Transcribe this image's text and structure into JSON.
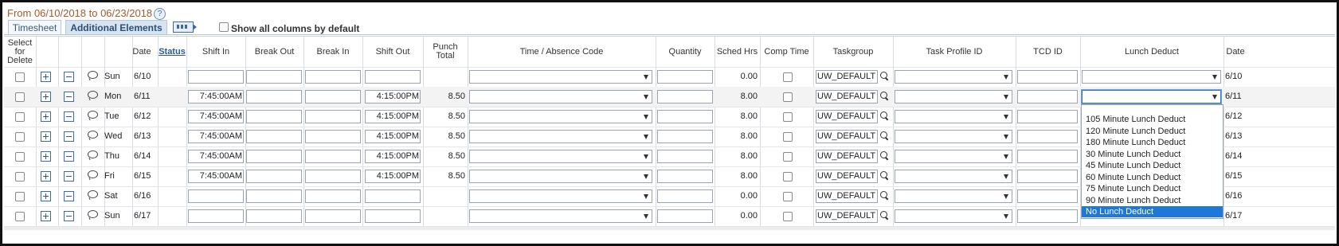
{
  "header": {
    "range_title": "From 06/10/2018 to 06/23/2018",
    "help_glyph": "?",
    "tabs": [
      "Timesheet",
      "Additional Elements"
    ],
    "active_tab": "Additional Elements",
    "show_all_label": "Show all columns by default"
  },
  "columns": {
    "select_delete": "Select for Delete",
    "date": "Date",
    "status": "Status",
    "shift_in": "Shift In",
    "break_out": "Break Out",
    "break_in": "Break In",
    "shift_out": "Shift Out",
    "punch_total": "Punch Total",
    "time_absence": "Time / Absence Code",
    "quantity": "Quantity",
    "sched_hrs": "Sched Hrs",
    "comp_time": "Comp Time",
    "taskgroup": "Taskgroup",
    "task_profile": "Task Profile ID",
    "tcd_id": "TCD ID",
    "lunch_deduct": "Lunch Deduct",
    "date2": "Date"
  },
  "rows": [
    {
      "day": "Sun",
      "date": "6/10",
      "shift_in": "",
      "shift_out": "",
      "punch_total": "",
      "sched": "0.00",
      "taskgroup": "UW_DEFAULT",
      "date2": "6/10"
    },
    {
      "day": "Mon",
      "date": "6/11",
      "shift_in": "7:45:00AM",
      "shift_out": "4:15:00PM",
      "punch_total": "8.50",
      "sched": "8.00",
      "taskgroup": "UW_DEFAULT",
      "date2": "6/11"
    },
    {
      "day": "Tue",
      "date": "6/12",
      "shift_in": "7:45:00AM",
      "shift_out": "4:15:00PM",
      "punch_total": "8.50",
      "sched": "8.00",
      "taskgroup": "UW_DEFAULT",
      "date2": "6/12"
    },
    {
      "day": "Wed",
      "date": "6/13",
      "shift_in": "7:45:00AM",
      "shift_out": "4:15:00PM",
      "punch_total": "8.50",
      "sched": "8.00",
      "taskgroup": "UW_DEFAULT",
      "date2": "6/13"
    },
    {
      "day": "Thu",
      "date": "6/14",
      "shift_in": "7:45:00AM",
      "shift_out": "4:15:00PM",
      "punch_total": "8.50",
      "sched": "8.00",
      "taskgroup": "UW_DEFAULT",
      "date2": "6/14"
    },
    {
      "day": "Fri",
      "date": "6/15",
      "shift_in": "7:45:00AM",
      "shift_out": "4:15:00PM",
      "punch_total": "8.50",
      "sched": "8.00",
      "taskgroup": "UW_DEFAULT",
      "date2": "6/15"
    },
    {
      "day": "Sat",
      "date": "6/16",
      "shift_in": "",
      "shift_out": "",
      "punch_total": "",
      "sched": "0.00",
      "taskgroup": "UW_DEFAULT",
      "date2": "6/16"
    },
    {
      "day": "Sun",
      "date": "6/17",
      "shift_in": "",
      "shift_out": "",
      "punch_total": "",
      "sched": "0.00",
      "taskgroup": "UW_DEFAULT",
      "date2": "6/17"
    }
  ],
  "lunch_deduct_options": [
    "105 Minute Lunch Deduct",
    "120 Minute Lunch Deduct",
    "180 Minute Lunch Deduct",
    "30 Minute Lunch Deduct",
    "45 Minute Lunch Deduct",
    "60 Minute Lunch Deduct",
    "75 Minute Lunch Deduct",
    "90 Minute Lunch Deduct",
    "No Lunch Deduct"
  ],
  "lunch_deduct_highlighted": "No Lunch Deduct",
  "icons": {
    "help": "help-icon",
    "tab_expand": "tab-expand-icon",
    "add_row": "plus-icon",
    "delete_row": "minus-icon",
    "comment": "comment-icon",
    "lookup": "magnifier-icon",
    "dropdown": "chevron-down-icon"
  }
}
